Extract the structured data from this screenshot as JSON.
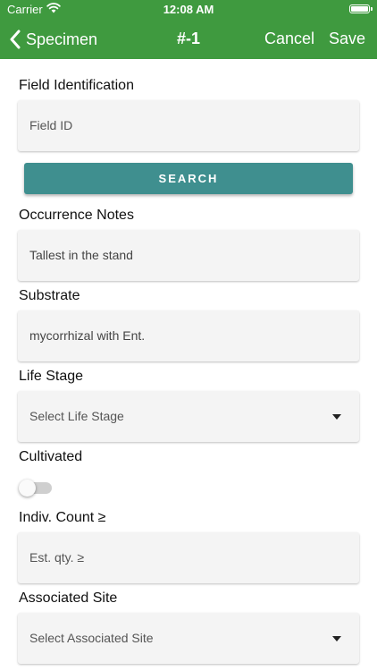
{
  "status_bar": {
    "carrier": "Carrier",
    "time": "12:08 AM",
    "wifi_icon": "wifi-icon",
    "battery_icon": "battery-icon",
    "battery_level": 1.0
  },
  "nav": {
    "back_label": "Specimen",
    "back_icon": "chevron-left-icon",
    "title": "#-1",
    "cancel_label": "Cancel",
    "save_label": "Save"
  },
  "form": {
    "field_identification": {
      "label": "Field Identification",
      "placeholder": "Field ID",
      "value": ""
    },
    "search_label": "SEARCH",
    "occurrence_notes": {
      "label": "Occurrence Notes",
      "value": "Tallest in the stand"
    },
    "substrate": {
      "label": "Substrate",
      "value": "mycorrhizal with Ent."
    },
    "life_stage": {
      "label": "Life Stage",
      "placeholder": "Select Life Stage"
    },
    "cultivated": {
      "label": "Cultivated",
      "checked": false
    },
    "indiv_count": {
      "label": "Indiv. Count ≥",
      "placeholder": "Est. qty. ≥",
      "value": ""
    },
    "associated_site": {
      "label": "Associated Site",
      "placeholder": "Select Associated Site"
    }
  },
  "colors": {
    "header_green": "#3f9a3f",
    "search_teal": "#3f8f8f",
    "field_background": "#f4f4f4"
  }
}
